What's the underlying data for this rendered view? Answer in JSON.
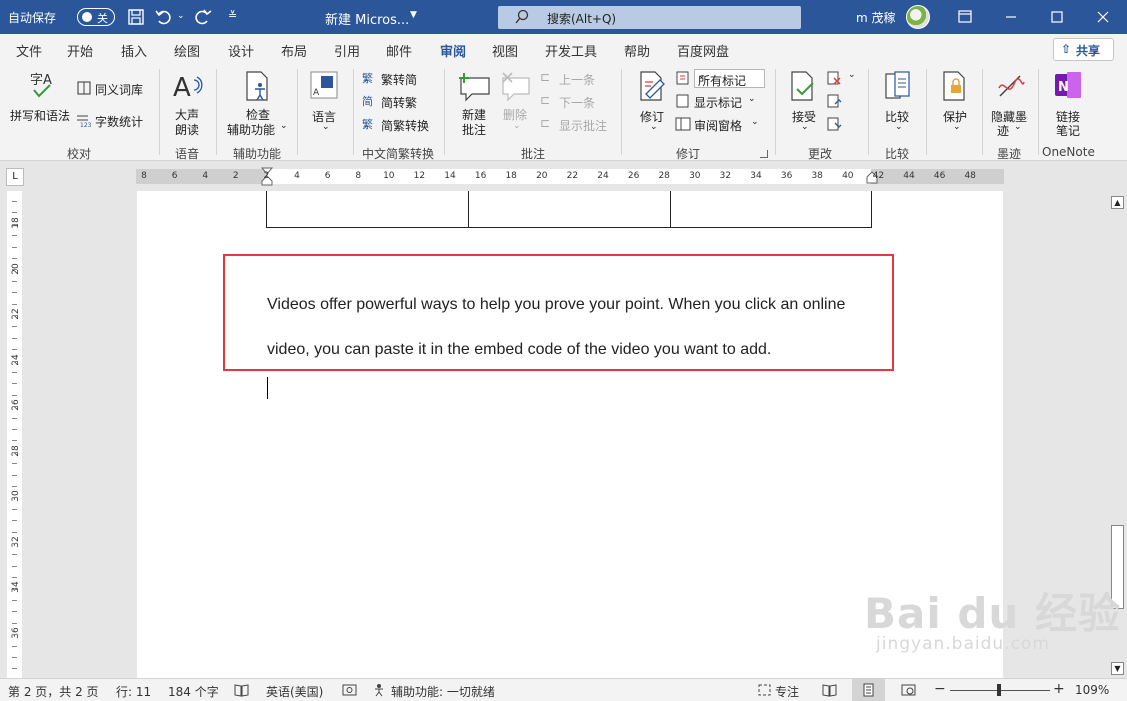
{
  "titlebar": {
    "autosave_label": "自动保存",
    "autosave_state": "关",
    "doc_title": "新建 Micros...",
    "search_placeholder": "搜索(Alt+Q)",
    "user_name": "m 茂稼",
    "accent": "#2b579a"
  },
  "ribbon_tabs": {
    "file": "文件",
    "home": "开始",
    "insert": "插入",
    "draw": "绘图",
    "design": "设计",
    "layout": "布局",
    "references": "引用",
    "mailings": "邮件",
    "review": "审阅",
    "view": "视图",
    "developer": "开发工具",
    "help": "帮助",
    "baidu": "百度网盘",
    "share": "共享"
  },
  "ribbon": {
    "proofing": {
      "spelling": "拼写和语法",
      "thesaurus": "同义词库",
      "wordcount": "字数统计",
      "label": "校对"
    },
    "speech": {
      "read_aloud_1": "大声",
      "read_aloud_2": "朗读",
      "label": "语音"
    },
    "accessibility": {
      "check_1": "检查",
      "check_2": "辅助功能",
      "label": "辅助功能"
    },
    "language": {
      "language": "语言",
      "label": ""
    },
    "chinese": {
      "to_simplified": "繁转简",
      "to_traditional": "简转繁",
      "convert": "简繁转换",
      "label": "中文简繁转换"
    },
    "comments": {
      "new_1": "新建",
      "new_2": "批注",
      "delete": "删除",
      "previous": "上一条",
      "next": "下一条",
      "show": "显示批注",
      "label": "批注"
    },
    "tracking": {
      "track": "修订",
      "markup_combo": "所有标记",
      "show_markup": "显示标记",
      "pane": "审阅窗格",
      "label": "修订"
    },
    "changes": {
      "accept": "接受",
      "label": "更改"
    },
    "compare": {
      "compare": "比较",
      "label": "比较"
    },
    "protect": {
      "protect": "保护",
      "label": ""
    },
    "ink": {
      "hide_1": "隐藏墨",
      "hide_2": "迹",
      "label": "墨迹"
    },
    "onenote": {
      "link_1": "链接",
      "link_2": "笔记",
      "label": "OneNote"
    }
  },
  "hruler_numbers": [
    "8",
    "6",
    "4",
    "2",
    "2",
    "4",
    "6",
    "8",
    "10",
    "12",
    "14",
    "16",
    "18",
    "20",
    "22",
    "24",
    "26",
    "28",
    "30",
    "32",
    "34",
    "36",
    "38",
    "40",
    "42",
    "44",
    "46",
    "48"
  ],
  "vruler_numbers": [
    "18",
    "20",
    "22",
    "24",
    "26",
    "28",
    "30",
    "32",
    "34",
    "36"
  ],
  "document": {
    "paragraph": "Videos offer powerful ways to help you prove your point. When you click an online video, you can paste it in the embed code of the video you want to add.",
    "highlight_color": "#e0393e"
  },
  "statusbar": {
    "page": "第 2 页，共 2 页",
    "line": "行: 11",
    "words": "184 个字",
    "language": "英语(美国)",
    "accessibility": "辅助功能: 一切就绪",
    "focus": "专注",
    "zoom": "109%"
  },
  "watermark": {
    "line1": "Bai du 经验",
    "line2": "jingyan.baidu.com"
  }
}
